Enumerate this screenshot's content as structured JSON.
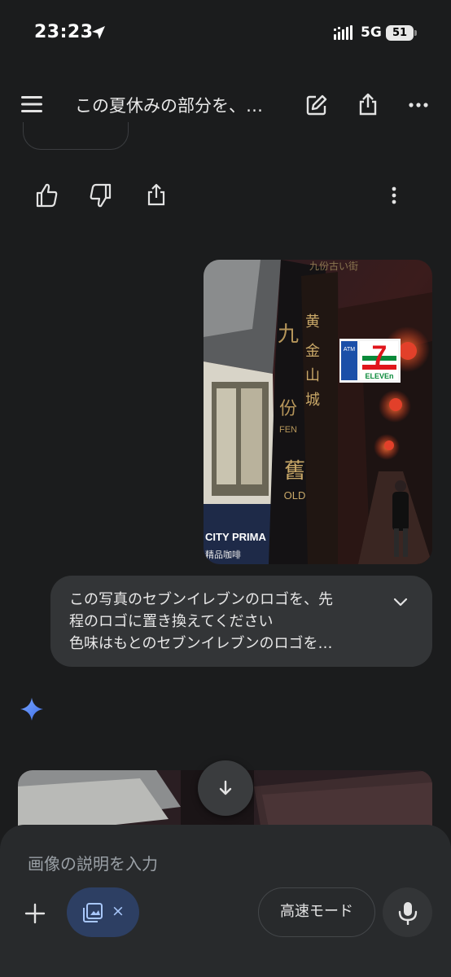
{
  "status_bar": {
    "time": "23:23",
    "network": "5G",
    "battery": "51",
    "icons": [
      "location-arrow-icon",
      "signal-bars-icon",
      "battery-icon"
    ]
  },
  "header": {
    "title": "この夏休みの部分を、…",
    "icons": [
      "menu-icon",
      "edit-icon",
      "share-icon",
      "more-vert-icon"
    ]
  },
  "feedback_icons": [
    "thumbs-up-icon",
    "thumbs-down-icon",
    "share-icon",
    "more-vert-icon"
  ],
  "photo": {
    "signs": {
      "seven_eleven": "ELEVEn",
      "seven_digit": "7",
      "atm": "ATM",
      "shop_sign": "CITY PRIMA",
      "shop_sub": "精品咖啡",
      "top_sign": "九份古い街",
      "pillar_chars": [
        "黄",
        "金",
        "山",
        "城"
      ],
      "pillar_left_chars": [
        "九",
        "份"
      ],
      "fen_label": "FEN",
      "old_char": "舊",
      "old_label": "OLD"
    }
  },
  "prompt": {
    "text": "この写真のセブンイレブンのロゴを、先\n程のロゴに置き換えてください\n色味はもとのセブンイレブンのロゴを…"
  },
  "composer": {
    "placeholder": "画像の説明を入力",
    "attachment_close": "×",
    "mode_label": "高速モード"
  },
  "colors": {
    "background": "#1b1c1d",
    "bubble": "#333537",
    "composer": "#282a2c",
    "chip": "#2d3f63",
    "accent_blue": "#a8c7fa"
  }
}
